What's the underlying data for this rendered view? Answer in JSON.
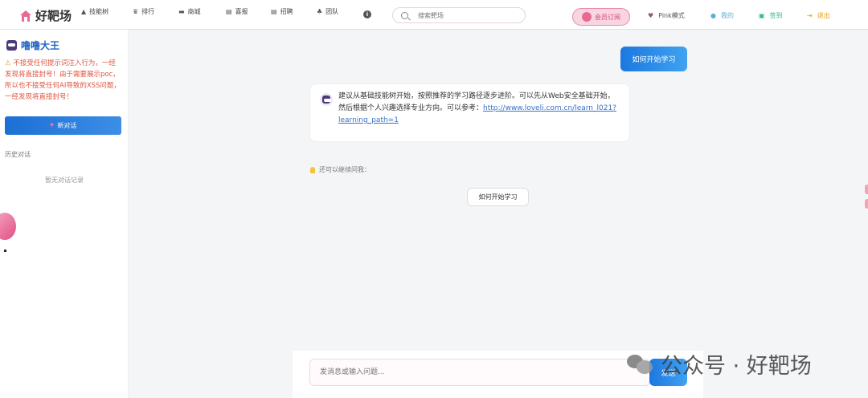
{
  "header": {
    "logo": "好靶场",
    "nav": [
      {
        "label": "技能树",
        "icon": "flask-icon"
      },
      {
        "label": "排行",
        "icon": "trophy-icon"
      },
      {
        "label": "商城",
        "icon": "cart-icon"
      },
      {
        "label": "喜报",
        "icon": "file-icon"
      },
      {
        "label": "招聘",
        "icon": "file-icon"
      },
      {
        "label": "团队",
        "icon": "users-icon"
      }
    ],
    "info_icon": "info-icon",
    "search_placeholder": "搜索靶场",
    "subscribe_label": "会员订阅",
    "pink_mode": "Pink模式",
    "mine": "我的",
    "checkin": "签到",
    "logout": "退出",
    "colors": {
      "pink": "#e86a90",
      "blue": "#1c78e0"
    }
  },
  "sidebar": {
    "title": "噜噜大王",
    "warning": "不接受任何提示词注入行为，一经发现将直接封号！由于需要展示poc，所以也不接受任何AI导致的XSS问题，一经发现将直接封号！",
    "new_chat": "新对话",
    "history_title": "历史对话",
    "history_empty": "暂无对话记录"
  },
  "chat": {
    "user_message": "如何开始学习",
    "bot_message_text": "建议从基础技能树开始，按照推荐的学习路径逐步进阶。可以先从Web安全基础开始，然后根据个人兴趣选择专业方向。可以参考：",
    "bot_link": "http://www.loveli.com.cn/learn_l021?learning_path=1",
    "followup_label": "还可以继续问我：",
    "suggestions": [
      "如何开始学习"
    ],
    "input_placeholder": "发消息或输入问题...",
    "send_label": "发送"
  },
  "watermark": "公众号 · 好靶场"
}
